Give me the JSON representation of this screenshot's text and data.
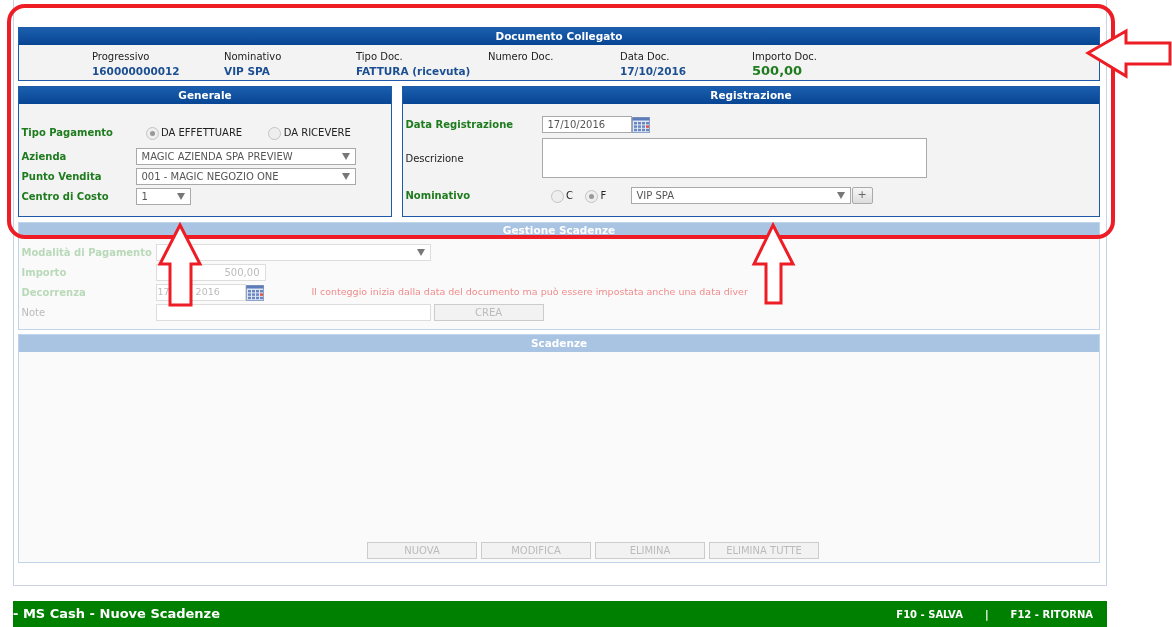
{
  "documento": {
    "title": "Documento Collegato",
    "fields": [
      {
        "label": "Progressivo",
        "value": "160000000012",
        "kind": "text"
      },
      {
        "label": "Nominativo",
        "value": "VIP SPA",
        "kind": "text"
      },
      {
        "label": "Tipo Doc.",
        "value": "FATTURA (ricevuta)",
        "kind": "text"
      },
      {
        "label": "Numero Doc.",
        "kind": "text"
      },
      {
        "label": "Data Doc.",
        "value": "17/10/2016",
        "kind": "text"
      },
      {
        "label": "Importo Doc.",
        "value": "500,00",
        "kind": "amount"
      }
    ]
  },
  "generale": {
    "title": "Generale",
    "rows": [
      {
        "kind": "radio",
        "label": "Tipo Pagamento",
        "required": true,
        "options": [
          {
            "label": "DA EFFETTUARE",
            "selected": true
          },
          {
            "label": "DA RICEVERE",
            "selected": false
          }
        ]
      },
      {
        "kind": "select",
        "label": "Azienda",
        "required": true,
        "value": "MAGIC AZIENDA SPA PREVIEW"
      },
      {
        "kind": "select",
        "label": "Punto Vendita",
        "required": true,
        "value": "001 - MAGIC NEGOZIO ONE"
      },
      {
        "kind": "short-select",
        "label": "Centro di Costo",
        "required": true,
        "value": "1"
      }
    ]
  },
  "registrazione": {
    "title": "Registrazione",
    "rows": [
      {
        "kind": "date",
        "label": "Data Registrazione",
        "required": true,
        "value": "17/10/2016"
      },
      {
        "kind": "textarea",
        "label": "Descrizione",
        "required": false
      },
      {
        "kind": "radio-select",
        "label": "Nominativo",
        "required": true,
        "options": [
          {
            "label": "C",
            "selected": false
          },
          {
            "label": "F",
            "selected": true
          }
        ],
        "value": "VIP SPA",
        "button": "+"
      }
    ]
  },
  "gestione": {
    "title": "Gestione Scadenze",
    "disabled": true,
    "rows": [
      {
        "kind": "select",
        "label": "Modalità di Pagamento",
        "required": true
      },
      {
        "kind": "number",
        "label": "Importo",
        "required": true,
        "value": "500,00"
      },
      {
        "kind": "date",
        "label": "Decorrenza",
        "required": true,
        "value_parts": [
          "17",
          "2016"
        ],
        "hint": "Il conteggio inizia dalla data del documento ma può essere impostata anche una data diver"
      },
      {
        "kind": "text-button",
        "label": "Note",
        "required": false,
        "button": "CREA"
      }
    ]
  },
  "scadenze": {
    "title": "Scadenze",
    "disabled": true,
    "buttons": [
      "NUOVA",
      "MODIFICA",
      "ELIMINA",
      "ELIMINA TUTTE"
    ]
  },
  "footer": {
    "title": "- MS Cash - Nuove Scadenze",
    "actions": [
      "F10 - SALVA",
      "F12 - RITORNA"
    ],
    "separator": "|"
  }
}
